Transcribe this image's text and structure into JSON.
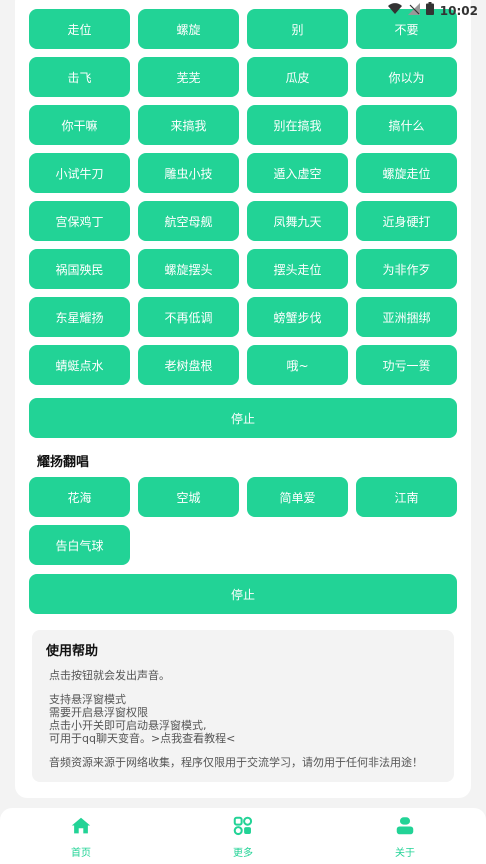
{
  "status": {
    "time": "10:02"
  },
  "colors": {
    "accent": "#22d396"
  },
  "buttons_top": [
    "走位",
    "螺旋",
    "别",
    "不要",
    "击飞",
    "芜芜",
    "瓜皮",
    "你以为",
    "你干嘛",
    "来搞我",
    "别在搞我",
    "搞什么",
    "小试牛刀",
    "雕虫小技",
    "遁入虚空",
    "螺旋走位",
    "宫保鸡丁",
    "航空母舰",
    "凤舞九天",
    "近身硬打",
    "祸国殃民",
    "螺旋摆头",
    "摆头走位",
    "为非作歹",
    "东星耀扬",
    "不再低调",
    "螃蟹步伐",
    "亚洲捆绑",
    "蜻蜓点水",
    "老树盘根",
    "哦~",
    "功亏一篑"
  ],
  "stop1": "停止",
  "section2_title": "耀扬翻唱",
  "buttons_songs": [
    "花海",
    "空城",
    "简单爱",
    "江南",
    "告白气球"
  ],
  "stop2": "停止",
  "help": {
    "title": "使用帮助",
    "line1": "点击按钮就会发出声音。",
    "line2": "支持悬浮窗模式",
    "line3": "需要开启悬浮窗权限",
    "line4": "点击小开关即可启动悬浮窗模式,",
    "line5": "可用于qq聊天变音。>点我查看教程<",
    "line6": "音频资源来源于网络收集，程序仅限用于交流学习，请勿用于任何非法用途！"
  },
  "nav": {
    "home": "首页",
    "more": "更多",
    "about": "关于"
  }
}
